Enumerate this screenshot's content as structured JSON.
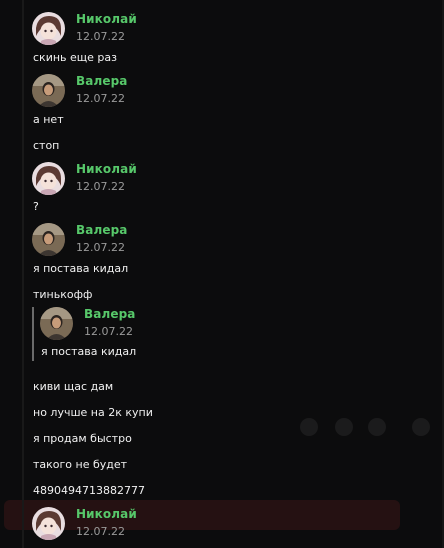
{
  "messages": [
    {
      "author": "Николай",
      "date": "12.07.22",
      "lines": [
        "скинь еще раз"
      ]
    },
    {
      "author": "Валера",
      "date": "12.07.22",
      "lines": [
        "а нет",
        "стоп"
      ]
    },
    {
      "author": "Николай",
      "date": "12.07.22",
      "lines": [
        "?"
      ]
    },
    {
      "author": "Валера",
      "date": "12.07.22",
      "lines": [
        "я постава кидал",
        "тинькофф"
      ],
      "quote": {
        "author": "Валера",
        "date": "12.07.22",
        "text": "я постава кидал"
      },
      "after_quote": [
        "киви щас дам",
        "но лучше на 2к купи",
        "я продам быстро",
        "такого не будет",
        "4890494713882777"
      ]
    },
    {
      "author": "Николай",
      "date": "12.07.22",
      "lines": []
    }
  ],
  "colors": {
    "author": "#57c86a",
    "date": "#9a9a9a",
    "text": "#f2f2f2",
    "background": "#0c0c0d"
  }
}
